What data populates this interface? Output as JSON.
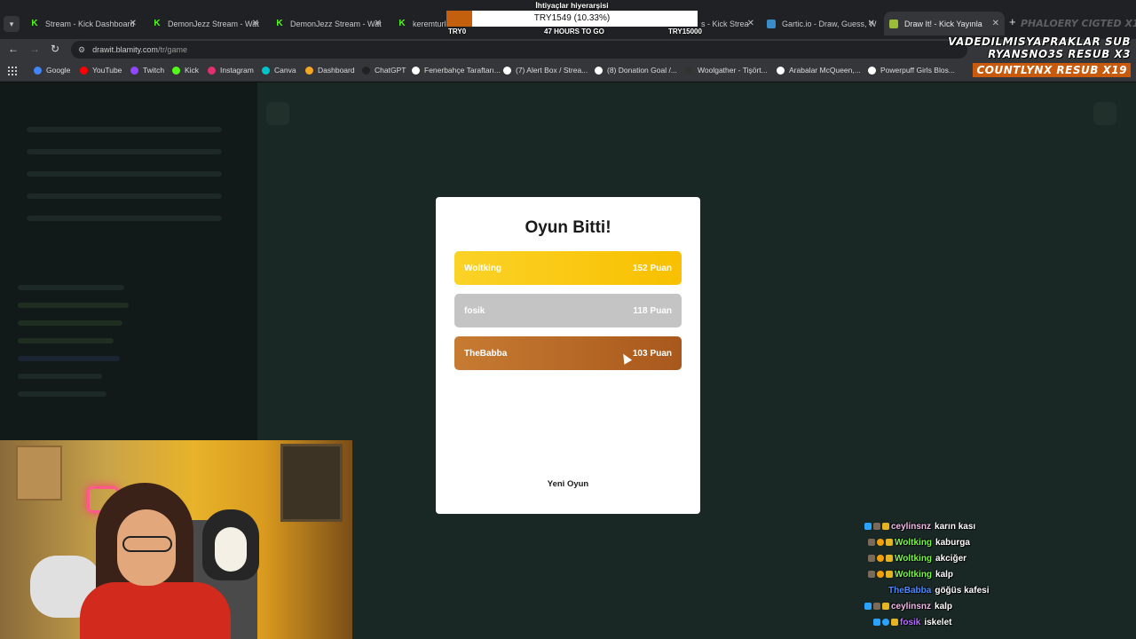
{
  "browser": {
    "tabs": [
      {
        "title": "Stream - Kick Dashboard",
        "icon": "kick"
      },
      {
        "title": "DemonJezz Stream - Wat",
        "icon": "kick"
      },
      {
        "title": "DemonJezz Stream - Wat",
        "icon": "kick"
      },
      {
        "title": "keremturke",
        "icon": "kick"
      },
      {
        "title": "s - Kick Strea",
        "icon": "none"
      },
      {
        "title": "Gartic.io - Draw, Guess, W",
        "icon": "gartic"
      },
      {
        "title": "Draw It! - Kick Yayınla",
        "icon": "draw"
      }
    ],
    "url_host": "drawit.blamity.com",
    "url_path": "/tr/game",
    "bookmarks": [
      {
        "label": "Google",
        "color": "#4285f4"
      },
      {
        "label": "YouTube",
        "color": "#ff0000"
      },
      {
        "label": "Twitch",
        "color": "#9146ff"
      },
      {
        "label": "Kick",
        "color": "#53fc18"
      },
      {
        "label": "Instagram",
        "color": "#e1306c"
      },
      {
        "label": "Canva",
        "color": "#00c4cc"
      },
      {
        "label": "Dashboard",
        "color": "#f5a623"
      },
      {
        "label": "ChatGPT",
        "color": "#222222"
      },
      {
        "label": "Fenerbahçe Taraftarı...",
        "color": "#ffffff"
      },
      {
        "label": "(7) Alert Box / Strea...",
        "color": "#ffffff"
      },
      {
        "label": "(8) Donation Goal /...",
        "color": "#ffffff"
      },
      {
        "label": "Woolgather - Tişört...",
        "color": "#333333"
      },
      {
        "label": "Arabalar McQueen,...",
        "color": "#ffffff"
      },
      {
        "label": "Powerpuff Girls Blos...",
        "color": "#ffffff"
      }
    ]
  },
  "goal": {
    "title": "İhtiyaçlar hiyerarşisi",
    "amount": "TRY1549 (10.33%)",
    "progress_percent": 10.33,
    "left_label": "TRY0",
    "center_label": "47 HOURS TO GO",
    "right_label": "TRY15000"
  },
  "subs_overlay": {
    "top_faded": "PHALOERY CIGTED X1",
    "line1": "VADEDILMISYAPRAKLAR SUB",
    "line2": "RYANSNO3S RESUB X3",
    "line3": "COUNTLYNX RESUB X19"
  },
  "modal": {
    "title": "Oyun Bitti!",
    "results": [
      {
        "name": "Woltking",
        "points": "152",
        "unit": "Puan",
        "rank": "gold"
      },
      {
        "name": "fosik",
        "points": "118",
        "unit": "Puan",
        "rank": "silver"
      },
      {
        "name": "TheBabba",
        "points": "103",
        "unit": "Puan",
        "rank": "bronze"
      }
    ],
    "new_game_label": "Yeni Oyun"
  },
  "chat": [
    {
      "user": "ceylinsnz",
      "text": "karın kası",
      "color": "#f2b8e8"
    },
    {
      "user": "Woltking",
      "text": "kaburga",
      "color": "#7cf54a"
    },
    {
      "user": "Woltking",
      "text": "akciğer",
      "color": "#7cf54a"
    },
    {
      "user": "Woltking",
      "text": "kalp",
      "color": "#7cf54a"
    },
    {
      "user": "TheBabba",
      "text": "göğüs kafesi",
      "color": "#4d8cff"
    },
    {
      "user": "ceylinsnz",
      "text": "kalp",
      "color": "#f2b8e8"
    },
    {
      "user": "fosik",
      "text": "iskelet",
      "color": "#b56cff"
    }
  ]
}
